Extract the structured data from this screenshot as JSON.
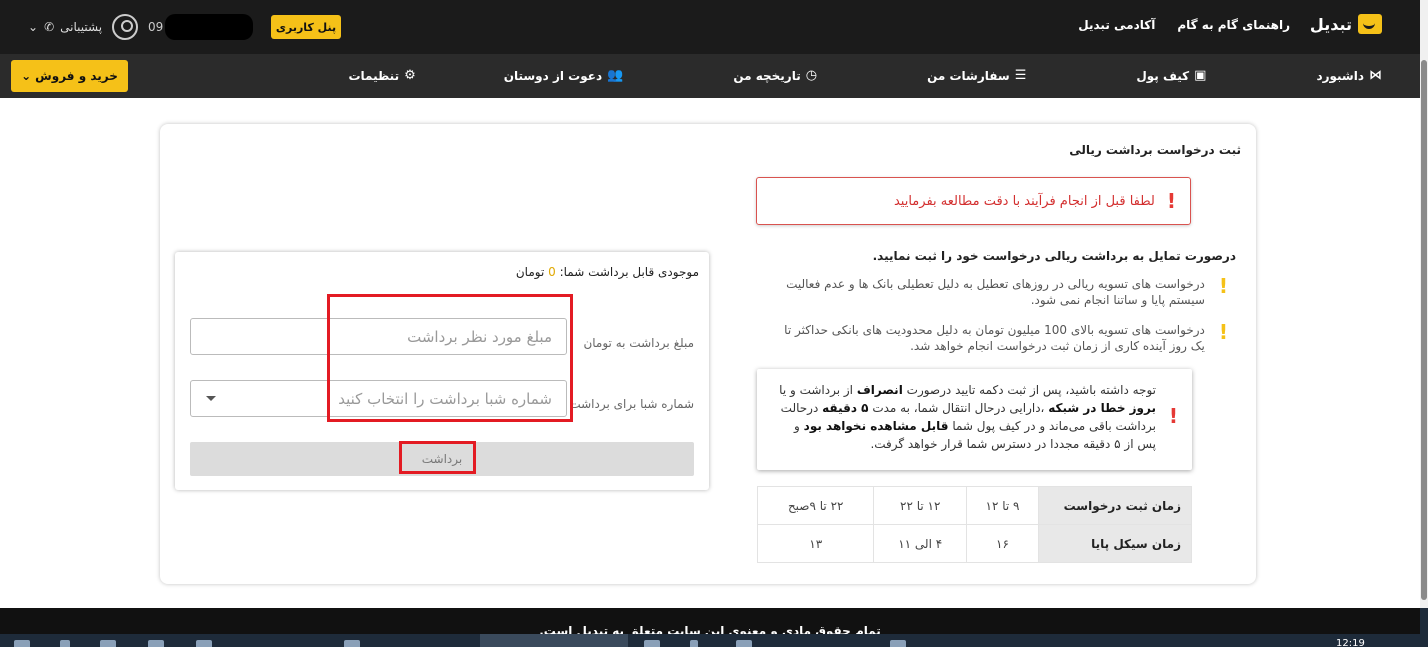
{
  "brand": {
    "name": "تبدیل"
  },
  "topnav": {
    "items": [
      "راهنمای گام به گام",
      "آکادمی تبدیل"
    ]
  },
  "user": {
    "support_label": "پشتیبانی",
    "phone_prefix": "09",
    "panel_button": "پنل کاربری"
  },
  "subnav": {
    "items": [
      {
        "label": "داشبورد",
        "icon": "dashboard-icon",
        "glyph": "⋈"
      },
      {
        "label": "کیف پول",
        "icon": "wallet-icon",
        "glyph": "▣"
      },
      {
        "label": "سفارشات من",
        "icon": "orders-icon",
        "glyph": "☰"
      },
      {
        "label": "تاریخچه من",
        "icon": "history-icon",
        "glyph": "◷"
      },
      {
        "label": "دعوت از دوستان",
        "icon": "friends-icon",
        "glyph": "👥"
      },
      {
        "label": "تنظیمات",
        "icon": "settings-icon",
        "glyph": "⚙"
      }
    ],
    "buy_sell_button": "خرید و فروش"
  },
  "page": {
    "title": "ثبت درخواست برداشت ریالی",
    "alert": "لطفا قبل از انجام فرآیند با دقت مطالعه بفرمایید",
    "intro": "درصورت تمایل به برداشت ریالی درخواست خود را ثبت نمایید.",
    "notes": [
      "درخواست های تسویه ریالی در روزهای تعطیل به دلیل تعطیلی بانک ها و عدم فعالیت سیستم پایا و ساتنا انجام نمی شود.",
      "درخواست های تسویه بالای 100 میلیون تومان به دلیل محدودیت های بانکی حداکثر تا یک روز آینده کاری از زمان ثبت درخواست انجام خواهد شد."
    ],
    "notice": {
      "p1": "توجه داشته باشید، پس از ثبت دکمه تایید درصورت",
      "b1": "انصراف",
      "p2": "از برداشت و یا",
      "b2": "بروز خطا در شبکه",
      "p3": "،دارایی درحال انتقال شما، به مدت",
      "b3": "۵ دقیقه",
      "p4": "درحالت برداشت باقی می‌ماند و در کیف پول شما",
      "b4": "قابل مشاهده نخواهد بود",
      "p5": "و پس از ۵ دقیقه مجددا در دسترس شما قرار خواهد گرفت."
    },
    "times_table": {
      "rows": [
        {
          "header": "زمان ثبت درخواست",
          "cells": [
            "۹ تا ۱۲",
            "۱۲ تا ۲۲",
            "۲۲ تا ۹صبح"
          ]
        },
        {
          "header": "زمان سیکل پایا",
          "cells": [
            "۱۶",
            "۴ الی ۱۱",
            "۱۳"
          ]
        }
      ]
    },
    "form": {
      "balance_label": "موجودی قابل برداشت شما:",
      "balance_value": "0",
      "balance_unit": "تومان",
      "amount_label": "مبلغ برداشت به تومان",
      "amount_placeholder": "مبلغ مورد نظر برداشت",
      "sheba_label": "شماره شبا برای برداشت",
      "sheba_placeholder": "شماره شبا برداشت را انتخاب کنید",
      "submit": "برداشت"
    }
  },
  "footer": {
    "text": "تمام حقوق مادی و معنوی این سایت متعلق به تبدیل است."
  },
  "taskbar": {
    "clock": "12:19"
  },
  "colors": {
    "accent": "#f5c118",
    "alert": "#e53935",
    "annotation": "#e31b23"
  }
}
